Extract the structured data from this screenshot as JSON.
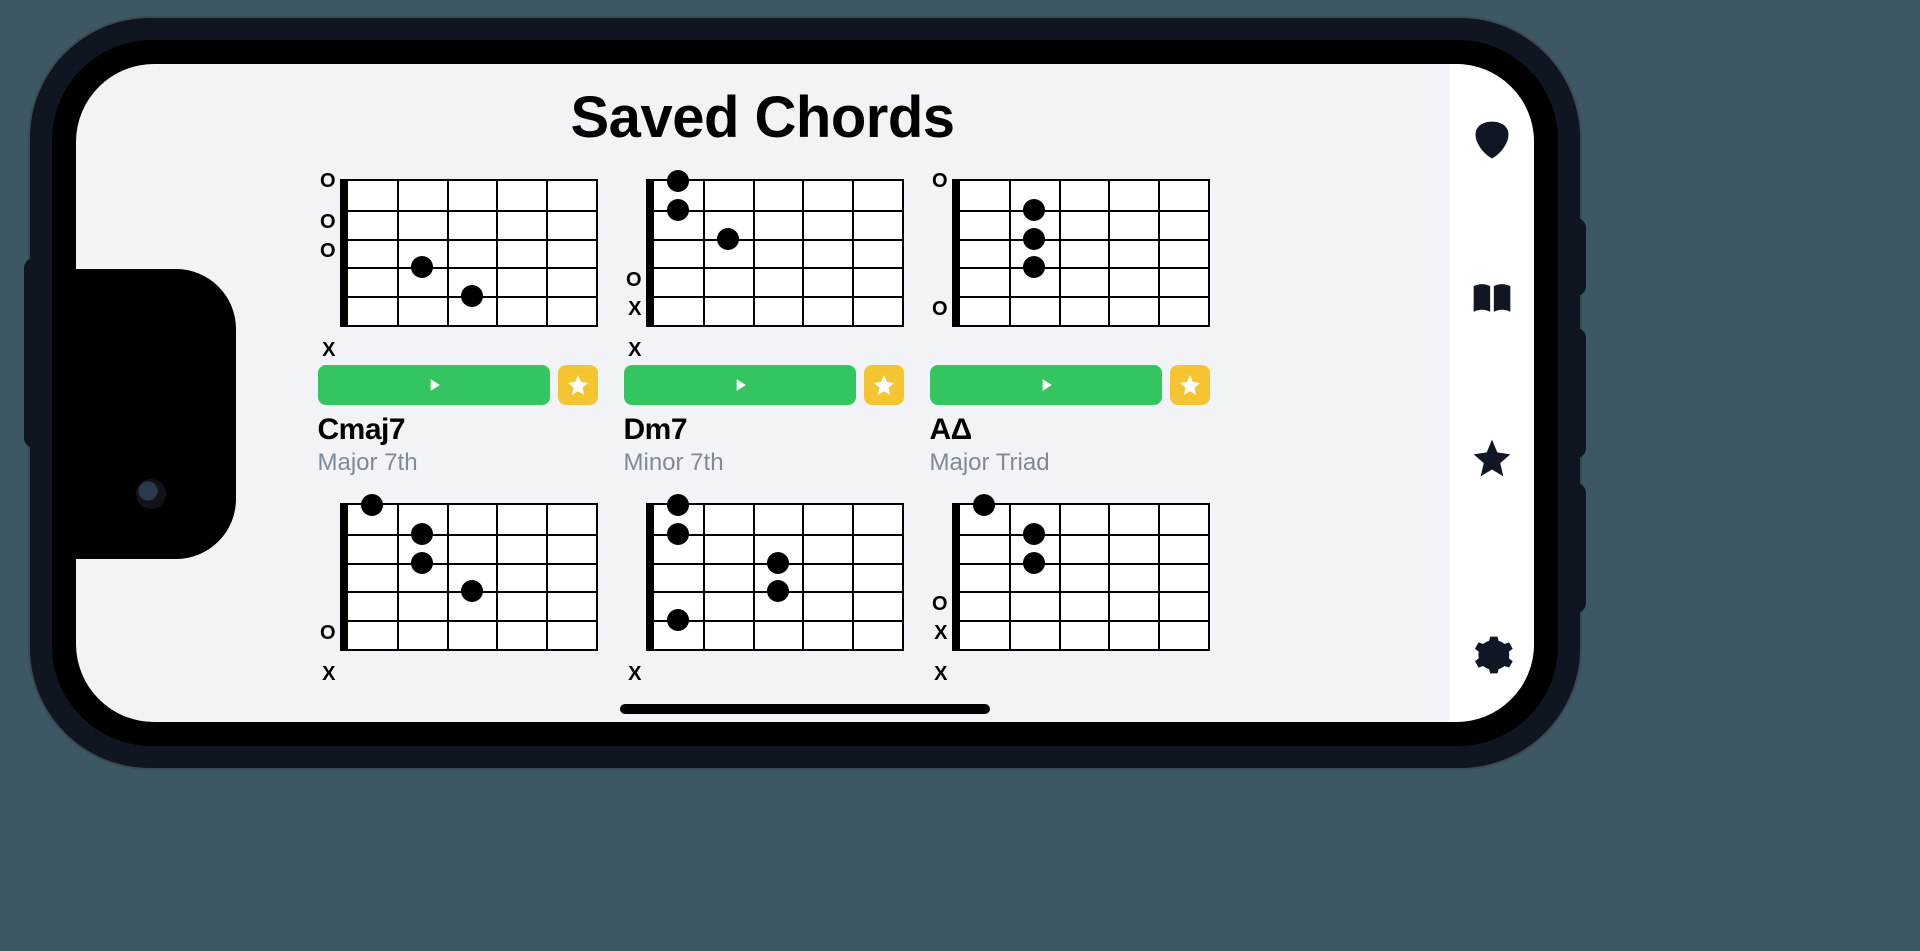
{
  "page": {
    "title": "Saved Chords"
  },
  "sidebar": {
    "items": [
      {
        "name": "pick-icon"
      },
      {
        "name": "book-icon"
      },
      {
        "name": "star-icon"
      },
      {
        "name": "settings-icon"
      }
    ]
  },
  "colors": {
    "play_button": "#35c560",
    "star_button": "#f4c531",
    "sidebar_icon": "#101624",
    "screen_bg": "#f1f3f6"
  },
  "chords": [
    {
      "name": "Cmaj7",
      "type": "Major 7th",
      "show_meta": true,
      "string_marks": [
        "O",
        "O",
        "O",
        "",
        "",
        "X"
      ],
      "dots": [
        {
          "string": 4,
          "fret": 2
        },
        {
          "string": 5,
          "fret": 3
        }
      ]
    },
    {
      "name": "Dm7",
      "type": "Minor 7th",
      "show_meta": true,
      "string_marks": [
        "",
        "",
        "",
        "O",
        "X",
        "X"
      ],
      "dots": [
        {
          "string": 1,
          "fret": 1
        },
        {
          "string": 2,
          "fret": 1
        },
        {
          "string": 3,
          "fret": 2
        }
      ]
    },
    {
      "name": "AΔ",
      "type": "Major Triad",
      "show_meta": true,
      "string_marks": [
        "O",
        "",
        "",
        "",
        "O",
        ""
      ],
      "dots": [
        {
          "string": 2,
          "fret": 2
        },
        {
          "string": 3,
          "fret": 2
        },
        {
          "string": 4,
          "fret": 2
        }
      ]
    },
    {
      "name": "",
      "type": "",
      "show_meta": false,
      "string_marks": [
        "",
        "",
        "",
        "",
        "O",
        "X"
      ],
      "dots": [
        {
          "string": 1,
          "fret": 1
        },
        {
          "string": 2,
          "fret": 2
        },
        {
          "string": 3,
          "fret": 2
        },
        {
          "string": 4,
          "fret": 3
        }
      ]
    },
    {
      "name": "",
      "type": "",
      "show_meta": false,
      "string_marks": [
        "",
        "",
        "",
        "",
        "",
        "X"
      ],
      "dots": [
        {
          "string": 1,
          "fret": 1
        },
        {
          "string": 2,
          "fret": 1
        },
        {
          "string": 3,
          "fret": 3
        },
        {
          "string": 4,
          "fret": 3
        },
        {
          "string": 5,
          "fret": 1
        }
      ]
    },
    {
      "name": "",
      "type": "",
      "show_meta": false,
      "string_marks": [
        "",
        "",
        "",
        "O",
        "X",
        "X"
      ],
      "dots": [
        {
          "string": 1,
          "fret": 1
        },
        {
          "string": 2,
          "fret": 2
        },
        {
          "string": 3,
          "fret": 2
        }
      ]
    }
  ]
}
